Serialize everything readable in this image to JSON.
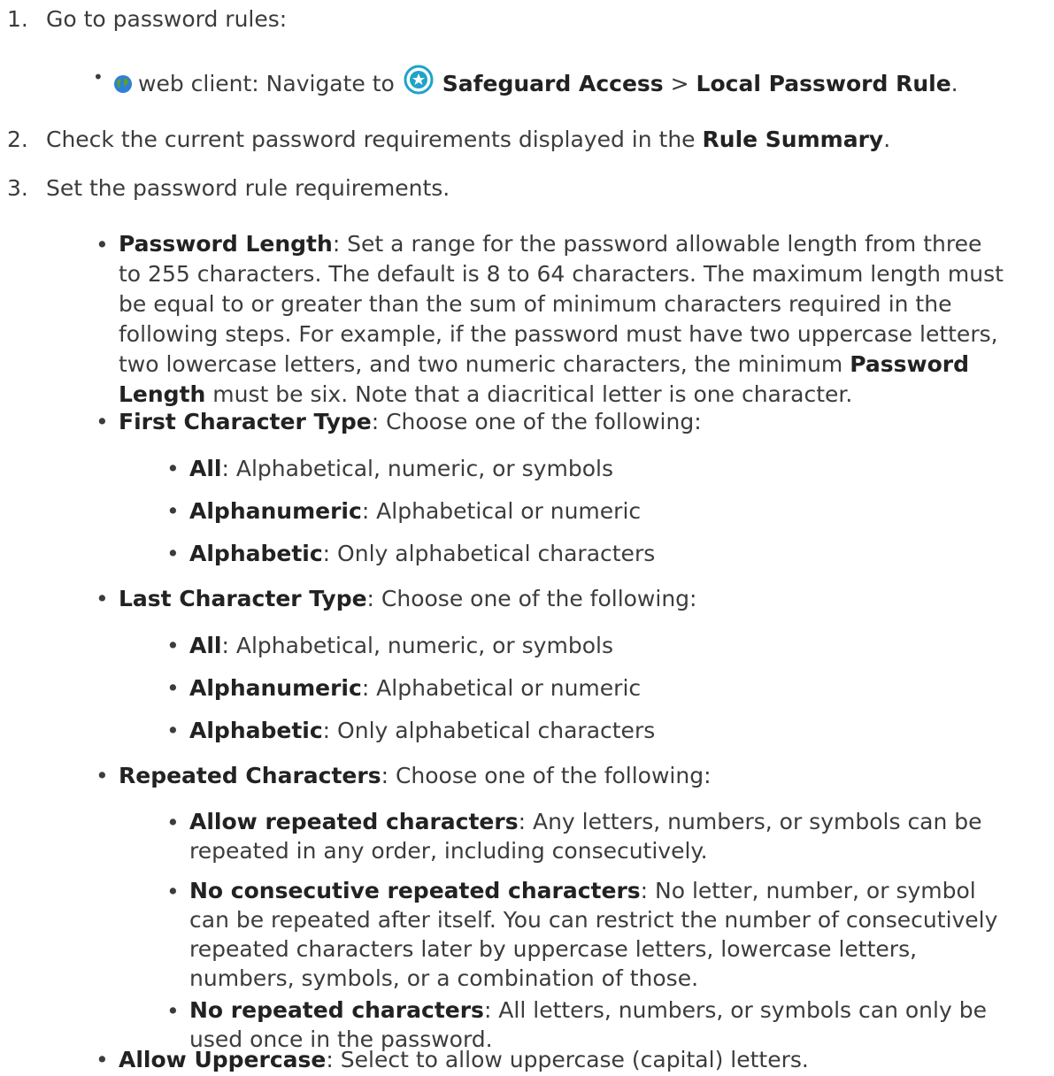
{
  "steps": [
    {
      "num": "1.",
      "text": "Go to password rules:",
      "bullet": {
        "icon_globe": "globe-icon",
        "prefix": "web client: Navigate to",
        "icon_star": "star-badge-icon",
        "nav1": "Safeguard Access",
        "sep": ">",
        "nav2": "Local Password Rule",
        "end": "."
      }
    },
    {
      "num": "2.",
      "before": "Check the current password requirements displayed in the",
      "bold": "Rule Summary",
      "after": "."
    },
    {
      "num": "3.",
      "text": "Set the password rule requirements."
    }
  ],
  "password_length": {
    "label": "Password Length",
    "lines": [
      ": Set a range for the password allowable length from three",
      "to 255 characters. The default is 8 to 64 characters. The maximum length must",
      "be equal to or greater than the sum of minimum characters required in the",
      "following steps. For example, if the password must have two uppercase letters,"
    ],
    "line5_before": "two lowercase letters, and two numeric characters, the minimum",
    "line5_bold": "Password",
    "line6_bold": "Length",
    "line6_after": " must be six. Note that a diacritical letter is one character."
  },
  "first_char": {
    "label": "First Character Type",
    "desc": ": Choose one of the following:",
    "options": [
      {
        "label": "All",
        "desc": ": Alphabetical, numeric, or symbols"
      },
      {
        "label": "Alphanumeric",
        "desc": ": Alphabetical or numeric"
      },
      {
        "label": "Alphabetic",
        "desc": ": Only alphabetical characters"
      }
    ]
  },
  "last_char": {
    "label": "Last Character Type",
    "desc": ": Choose one of the following:",
    "options": [
      {
        "label": "All",
        "desc": ": Alphabetical, numeric, or symbols"
      },
      {
        "label": "Alphanumeric",
        "desc": ": Alphabetical or numeric"
      },
      {
        "label": "Alphabetic",
        "desc": ": Only alphabetical characters"
      }
    ]
  },
  "repeated": {
    "label": "Repeated Characters",
    "desc": ": Choose one of the following:",
    "allow": {
      "label": "Allow repeated characters",
      "line1": ": Any letters, numbers, or symbols can be",
      "line2": "repeated in any order, including consecutively."
    },
    "no_consec": {
      "label": "No consecutive repeated characters",
      "line1": ": No letter, number, or symbol",
      "line2": "can be repeated after itself. You can restrict the number of consecutively",
      "line3": "repeated characters later by uppercase letters, lowercase letters,",
      "line4": "numbers, symbols, or a combination of those."
    },
    "none": {
      "label": "No repeated characters",
      "line1": ": All letters, numbers, or symbols can only be",
      "line2": "used once in the password."
    }
  },
  "allow_upper": {
    "label": "Allow Uppercase",
    "desc": ": Select to allow uppercase (capital) letters."
  },
  "colors": {
    "text": "#3c3c3c",
    "globe_blue": "#2f7fd6",
    "globe_green": "#5aa02c",
    "badge_teal": "#1ea3c9"
  }
}
